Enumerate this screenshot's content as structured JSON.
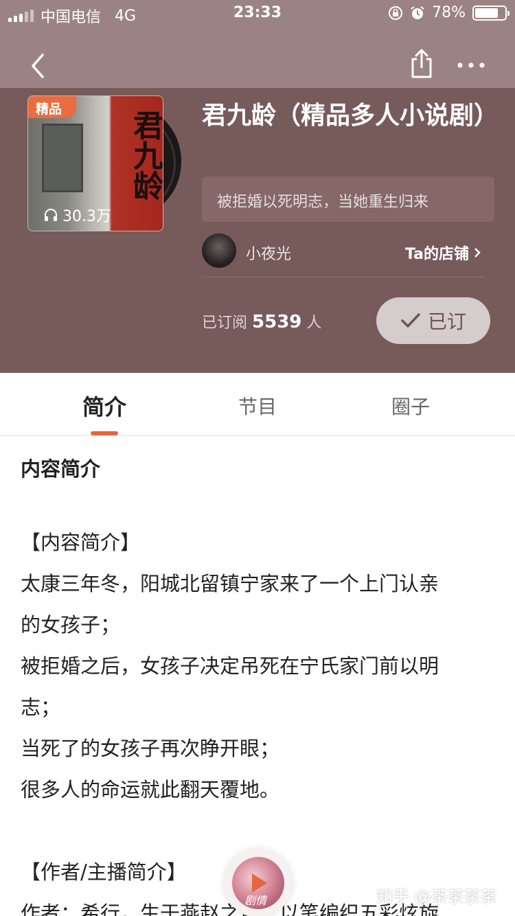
{
  "status_bar": {
    "carrier": "中国电信",
    "network": "4G",
    "time": "23:33",
    "battery": "78%",
    "battery_level": 0.78
  },
  "cover": {
    "badge": "精品",
    "calligraphy": "君九龄",
    "play_count": "30.3万"
  },
  "program": {
    "title": "君九龄（精品多人小说剧）",
    "tagline": "被拒婚以死明志，当她重生归来"
  },
  "host": {
    "name": "小夜光",
    "store_link": "Ta的店铺"
  },
  "subscription": {
    "prefix": "已订阅",
    "count": "5539",
    "suffix": "人",
    "button_label": "已订"
  },
  "tabs": [
    {
      "label": "简介",
      "active": true
    },
    {
      "label": "节目",
      "active": false
    },
    {
      "label": "圈子",
      "active": false
    }
  ],
  "intro": {
    "heading": "内容简介",
    "lines": [
      "【内容简介】",
      "太康三年冬，阳城北留镇宁家来了一个上门认亲",
      "的女孩子；",
      "被拒婚之后，女孩子决定吊死在宁氏家门前以明",
      "志；",
      "当死了的女孩子再次睁开眼；",
      "很多人的命运就此翻天覆地。",
      "",
      "【作者/主播简介】",
      "作者：希行，生于燕赵之地，以笔编织五彩炫旋"
    ]
  },
  "player": {
    "label": "剧情"
  },
  "watermark": "知乎 @茶茶茶茶"
}
